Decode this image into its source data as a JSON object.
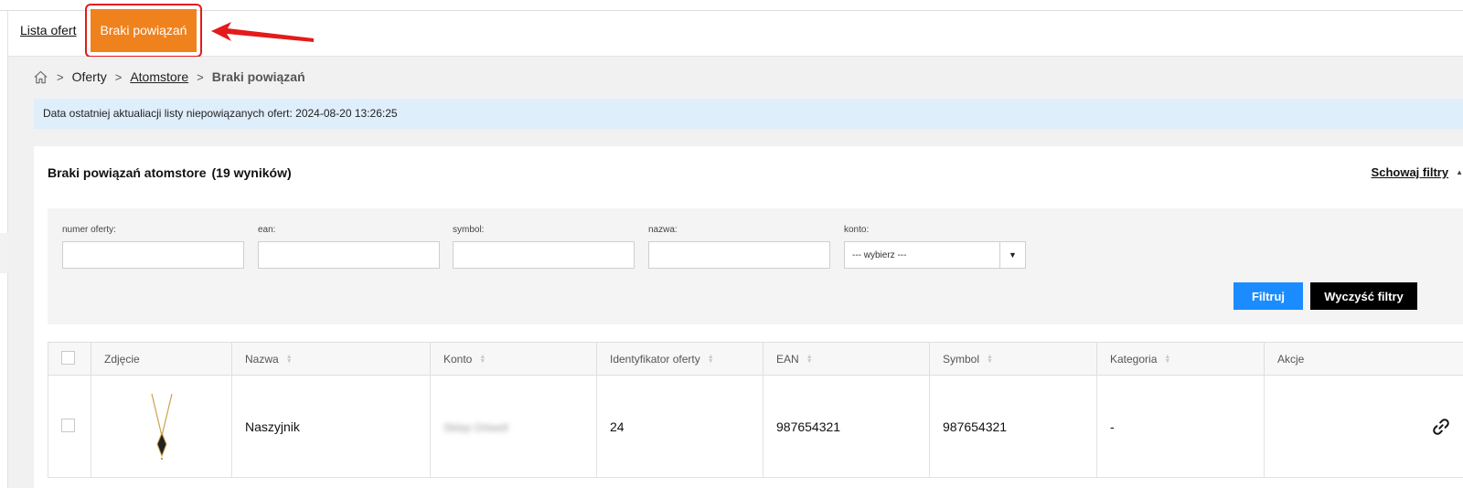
{
  "tabs": {
    "list_label": "Lista ofert",
    "active_label": "Braki powiązań"
  },
  "breadcrumb": {
    "items": [
      "Oferty",
      "Atomstore",
      "Braki powiązań"
    ]
  },
  "info": {
    "text": "Data ostatniej aktualiacji listy niepowiązanych ofert: 2024-08-20 13:26:25"
  },
  "panel": {
    "title": "Braki powiązań atomstore",
    "count": "(19 wyników)",
    "hide_filters": "Schowaj filtry"
  },
  "filters": {
    "offer_number_label": "numer oferty:",
    "ean_label": "ean:",
    "symbol_label": "symbol:",
    "name_label": "nazwa:",
    "account_label": "konto:",
    "account_value": "--- wybierz ---",
    "filter_button": "Filtruj",
    "clear_button": "Wyczyść filtry"
  },
  "table": {
    "headers": [
      "Zdjęcie",
      "Nazwa",
      "Konto",
      "Identyfikator oferty",
      "EAN",
      "Symbol",
      "Kategoria",
      "Akcje"
    ],
    "rows": [
      {
        "name": "Naszyjnik",
        "account": "Sklep Ortwell",
        "offer_id": "24",
        "ean": "987654321",
        "symbol": "987654321",
        "category": "-"
      }
    ]
  },
  "colors": {
    "accent_orange": "#f0821e",
    "annotation_red": "#e31b1b",
    "filter_blue": "#1a8cff",
    "info_bg": "#dfeefb"
  },
  "icons": [
    "home-icon",
    "link-icon",
    "sort-icon",
    "chevron-down-icon",
    "caret-up-icon"
  ]
}
